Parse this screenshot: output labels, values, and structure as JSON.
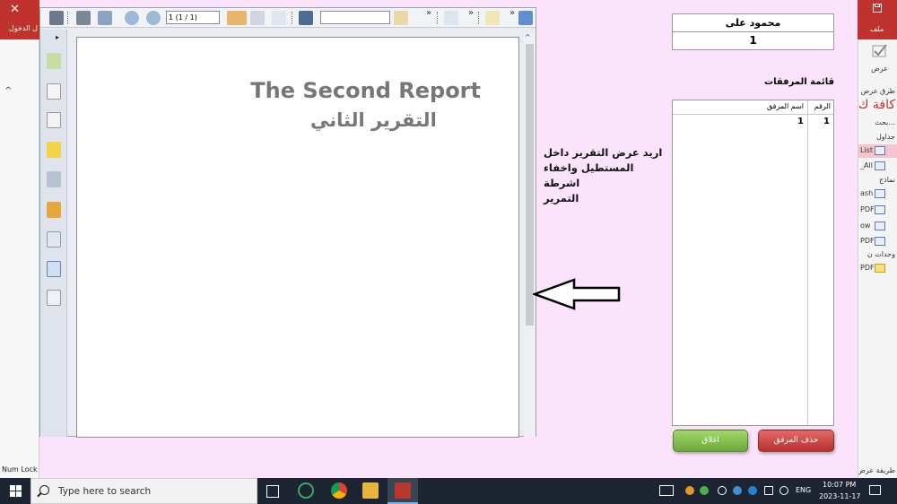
{
  "access_left": {
    "close_glyph": "✕",
    "login_label": "ل الدخول",
    "collapse_glyph": "^",
    "status": "Num Lock"
  },
  "access_right": {
    "file_label": "ملف",
    "view_label": "عرض",
    "view_method": "طرق عرض",
    "all_objects": "كافة ك",
    "search": "بحث...",
    "tables_group": "جداول",
    "forms_group": "نماذج",
    "modules_group": "وحدات ن",
    "items": [
      "List",
      "_All",
      "ash",
      "PDF",
      "ow",
      "PDF",
      "PDF"
    ],
    "bottom_status": "طريقة عرض"
  },
  "preview": {
    "page_field": "1 (1 / 1)",
    "overflow_glyph": "»",
    "expand_glyph": "▸",
    "report_title_en": "The Second Report",
    "report_title_ar": "التقرير الثاني",
    "scroll_up_glyph": "^"
  },
  "note": {
    "lines": [
      "اريد عرض التقرير داخل",
      "المستطيل واخفاء اشرطة",
      "التمرير"
    ]
  },
  "form": {
    "user_name": "محمود على",
    "user_id": "1",
    "list_title": "قائمة المرفقات",
    "columns": {
      "number": "الرقم",
      "name": "اسم المرفق"
    },
    "rows": [
      {
        "number": "1",
        "name": "1"
      }
    ],
    "close_button": "اغلاق",
    "delete_button": "حذف المرفق"
  },
  "taskbar": {
    "search_placeholder": "Type here to search",
    "language": "ENG",
    "time": "10:07 PM",
    "date": "2023-11-17"
  },
  "colors": {
    "background": "#fbe3fb",
    "access_red": "#c0322d",
    "close_green": "#7fb548",
    "delete_red": "#c9403b"
  }
}
